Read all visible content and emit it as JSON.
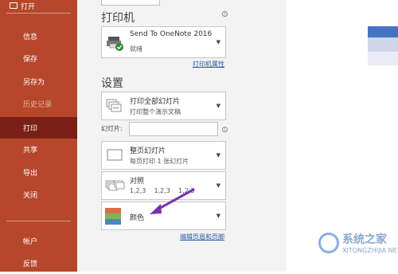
{
  "sidebar": {
    "open_label": "打开",
    "items": [
      {
        "label": "信息"
      },
      {
        "label": "保存"
      },
      {
        "label": "另存为"
      },
      {
        "label": "历史记录"
      },
      {
        "label": "打印"
      },
      {
        "label": "共享"
      },
      {
        "label": "导出"
      },
      {
        "label": "关闭"
      },
      {
        "label": "帐户"
      },
      {
        "label": "反馈"
      }
    ],
    "bg_color": "#b7472a",
    "active_color": "#7a1f18"
  },
  "printer": {
    "section_title": "打印机",
    "name": "Send To OneNote 2016",
    "status": "就绪",
    "properties_link": "打印机属性"
  },
  "settings": {
    "section_title": "设置",
    "print_range": {
      "title": "打印全部幻灯片",
      "subtitle": "打印整个演示文稿"
    },
    "slides_label": "幻灯片:",
    "slides_value": "",
    "layout": {
      "title": "整页幻灯片",
      "subtitle": "每页打印 1 张幻灯片"
    },
    "collate": {
      "title": "对照",
      "subtitle": "1,2,3    1,2,3    1,2,3"
    },
    "color": {
      "title": "颜色"
    },
    "edit_header_footer_link": "编辑页眉和页脚"
  },
  "watermark": {
    "name": "系统之家",
    "url": "XITONGZHIJIA.NET"
  },
  "annotation": {
    "arrow_color": "#7b2fb0"
  }
}
